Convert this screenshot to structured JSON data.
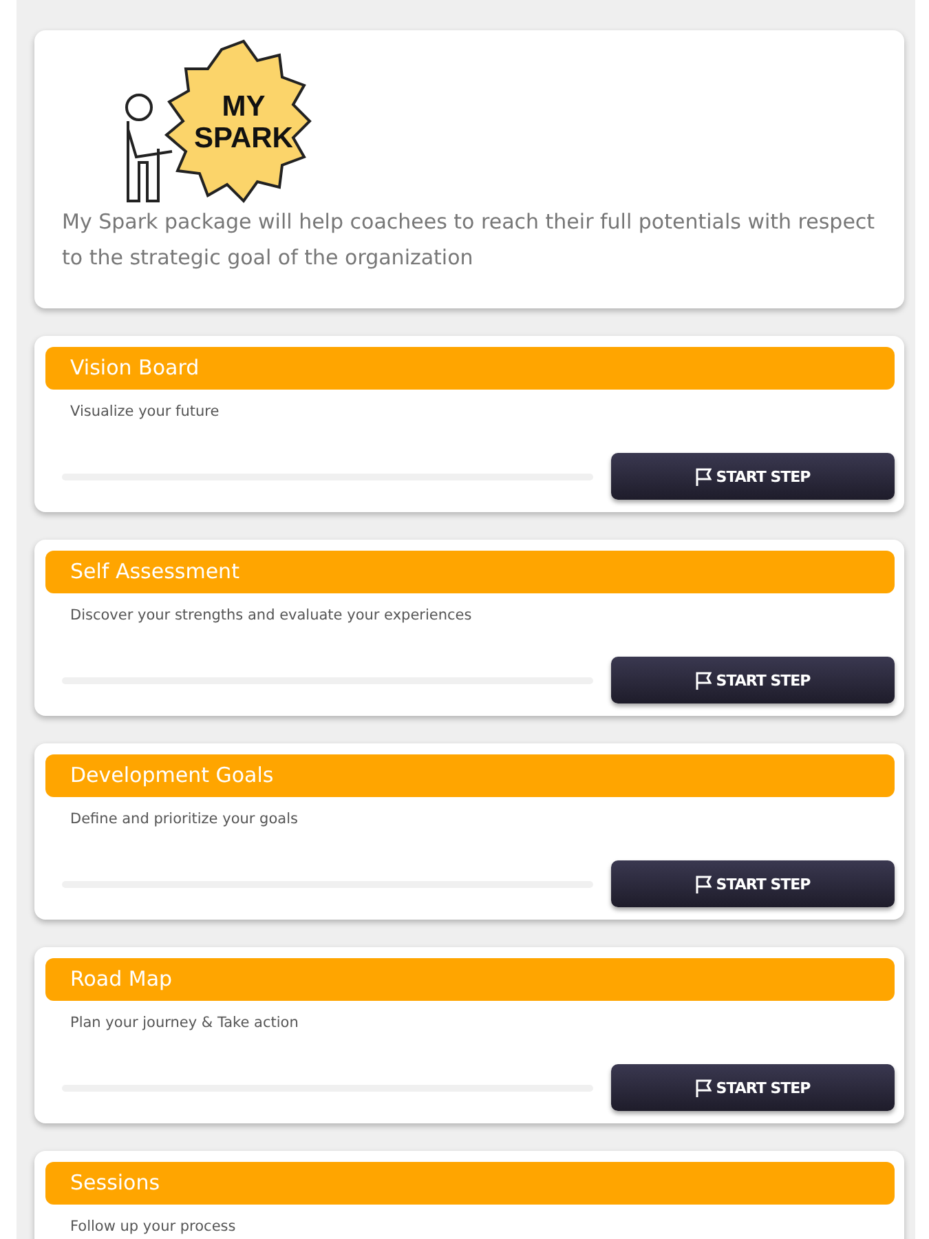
{
  "intro": {
    "logo_lines": [
      "MY",
      "SPARK"
    ],
    "description": "My Spark package will help coachees to reach their full potentials with respect to the strategic goal of the organization"
  },
  "steps": [
    {
      "title": "Vision Board",
      "subtitle": "Visualize your future",
      "level": 0,
      "button": "START STEP"
    },
    {
      "title": "Self Assessment",
      "subtitle": "Discover your strengths and evaluate your experiences",
      "level": 0,
      "button": "START STEP"
    },
    {
      "title": "Development Goals",
      "subtitle": "Define and prioritize your goals",
      "level": 0,
      "button": "START STEP"
    },
    {
      "title": "Road Map",
      "subtitle": "Plan your journey & Take action",
      "level": 0,
      "button": "START STEP"
    },
    {
      "title": "Sessions",
      "subtitle": "Follow up your process"
    }
  ]
}
